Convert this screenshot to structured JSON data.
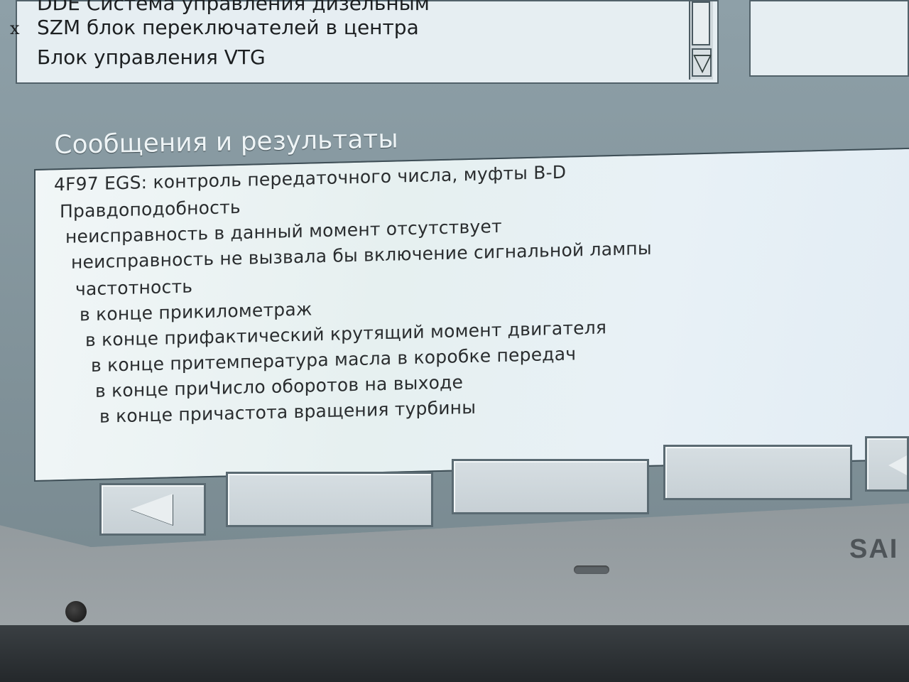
{
  "ecu_list": {
    "rows": [
      {
        "mark": "",
        "label": "DDE Система управления дизельным"
      },
      {
        "mark": "x",
        "label": "SZM блок переключателей в центра"
      },
      {
        "mark": "",
        "label": "Блок управления VTG"
      }
    ],
    "scroll_down_icon": "▽"
  },
  "messages": {
    "title": "Сообщения и результаты",
    "lines": [
      "4F97 EGS: контроль передаточного числа, муфты B-D",
      "Правдоподобность",
      "неисправность в данный момент отсутствует",
      "неисправность не вызвала бы включение сигнальной лампы",
      "частотность",
      "в конце прикилометраж",
      "в конце прифактический крутящий момент двигателя",
      "в конце притемпература масла в коробке передач",
      "в конце приЧисло оборотов на выходе",
      "в конце причастота вращения турбины"
    ]
  },
  "bezel": {
    "brand": "SAI"
  },
  "icons": {
    "back": "back-arrow-icon",
    "scroll_down": "scroll-down-icon"
  }
}
